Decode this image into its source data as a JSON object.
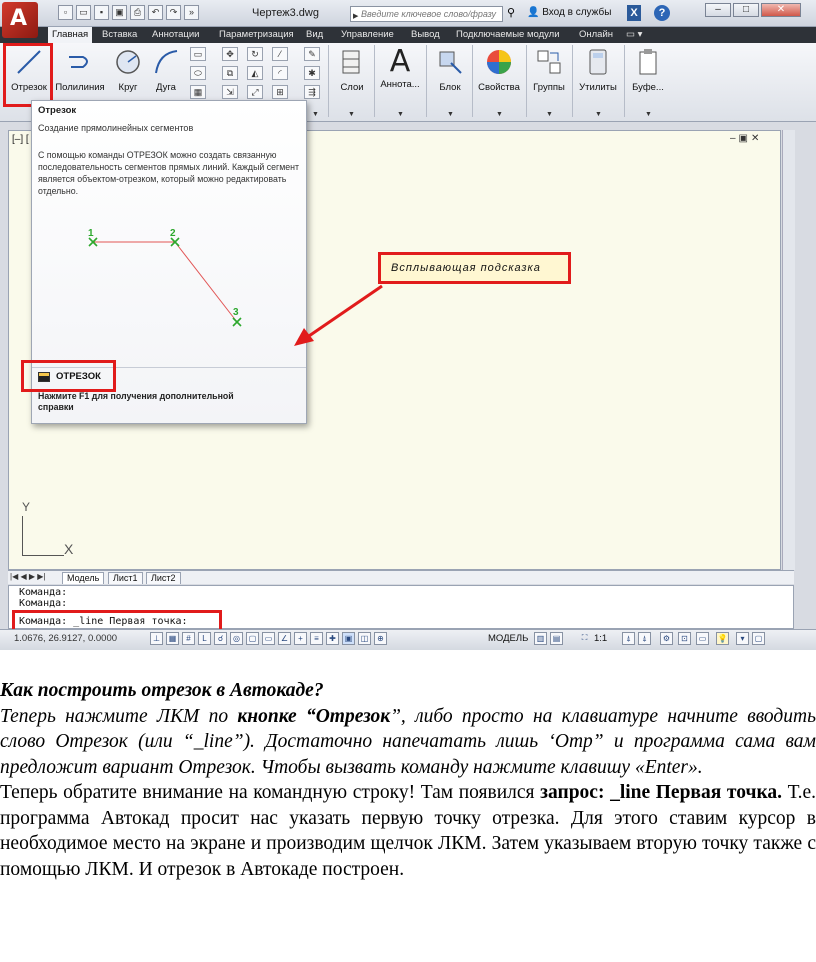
{
  "window": {
    "title": "Чертеж3.dwg",
    "search_placeholder": "Введите ключевое слово/фразу",
    "login": "Вход в службы",
    "x_button": "X",
    "help_button": "?"
  },
  "ribbon_tabs": [
    "Главная",
    "Вставка",
    "Аннотации",
    "Параметризация",
    "Вид",
    "Управление",
    "Вывод",
    "Подключаемые модули",
    "Онлайн"
  ],
  "ribbon_buttons": {
    "line": "Отрезок",
    "polyline": "Полилиния",
    "circle": "Круг",
    "arc": "Дуга",
    "layers": "Слои",
    "annotation": "Аннота...",
    "block": "Блок",
    "properties": "Свойства",
    "groups": "Группы",
    "utilities": "Утилиты",
    "clipboard": "Буфе..."
  },
  "viewport": {
    "label": "[–] [",
    "ucs_y": "Y",
    "ucs_x": "X"
  },
  "layout_tabs": [
    "Модель",
    "Лист1",
    "Лист2"
  ],
  "command_line": {
    "history": [
      "Команда:",
      "Команда:"
    ],
    "prompt": "Команда: _line Первая точка:"
  },
  "status": {
    "coords": "1.0676, 26.9127, 0.0000",
    "model": "МОДЕЛЬ",
    "scale": "1:1"
  },
  "tooltip": {
    "title": "Отрезок",
    "subtitle": "Создание прямолинейных сегментов",
    "description": "С помощью команды ОТРЕЗОК можно создать связанную последовательность сегментов прямых линий. Каждый сегмент является объектом-отрезком, который можно редактировать отдельно.",
    "points": [
      "1",
      "2",
      "3"
    ],
    "command": "ОТРЕЗОК",
    "help": "Нажмите F1 для получения дополнительной справки"
  },
  "callout": "Всплывающая подсказка",
  "article": {
    "heading": "Как построить отрезок в Автокаде?",
    "p1_a": "Теперь нажмите ЛКМ по ",
    "p1_b": "кнопке “Отрезок",
    "p1_c": "”, либо просто на клавиатуре начните вводить слово Отрезок (или “_line”). Достаточно напечатать лишь ‘Отр” и программа сама вам предложит вариант Отрезок. Чтобы вызвать команду нажмите клавишу «Enter».",
    "p2_a": "Теперь обратите внимание на командную строку! Там появился ",
    "p2_b": "запрос: _line Первая точка.",
    "p2_c": " Т.е. программа Автокад просит нас указать первую точку отрезка. Для этого ставим курсор в необходимое место на экране и производим щелчок ЛКМ. Затем указываем вторую точку также с помощью ЛКМ. И отрезок в Автокаде построен."
  }
}
